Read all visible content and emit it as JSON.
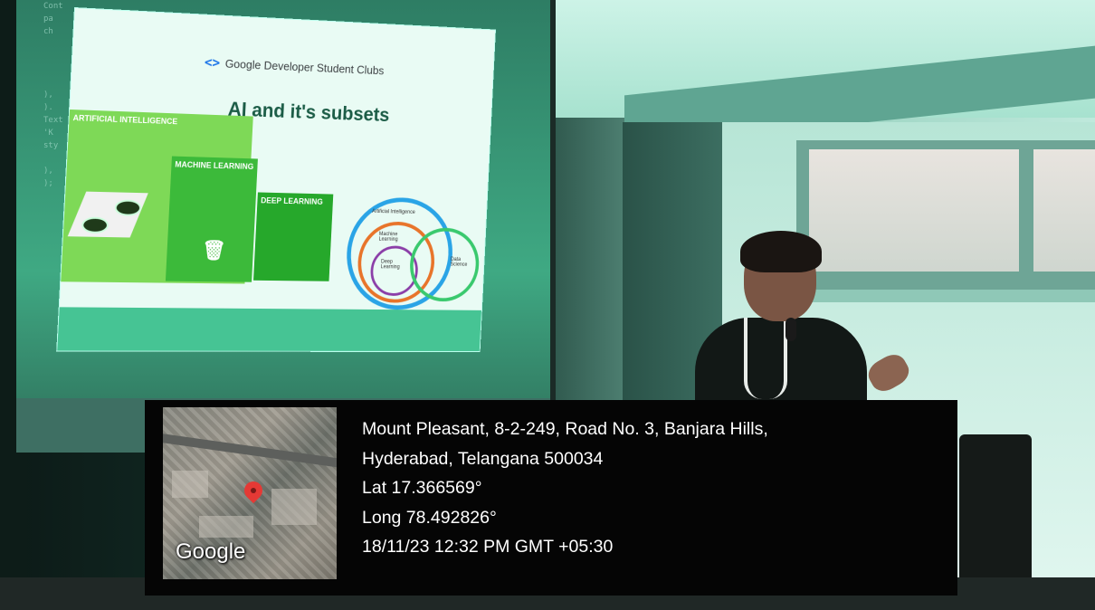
{
  "slide": {
    "brand_title": "Google Developer Student Clubs",
    "brand_icon": "code-bracket-icon",
    "heading": "AI and it's subsets",
    "panels": {
      "ai_title": "ARTIFICIAL INTELLIGENCE",
      "ml_title": "MACHINE LEARNING",
      "dl_title": "DEEP LEARNING"
    },
    "venn": {
      "artificial_intelligence": "Artificial Intelligence",
      "machine_learning": "Machine Learning",
      "deep_learning": "Deep Learning",
      "data_science": "Data Science"
    }
  },
  "geotag": {
    "map_logo": "Google",
    "address_line1": "Mount Pleasant, 8-2-249, Road No. 3, Banjara Hills,",
    "address_line2": "Hyderabad, Telangana 500034",
    "latitude": "Lat 17.366569°",
    "longitude": "Long 78.492826°",
    "timestamp": "18/11/23 12:32 PM GMT +05:30",
    "pin_icon": "map-pin-icon",
    "pin_color": "#e53935"
  }
}
